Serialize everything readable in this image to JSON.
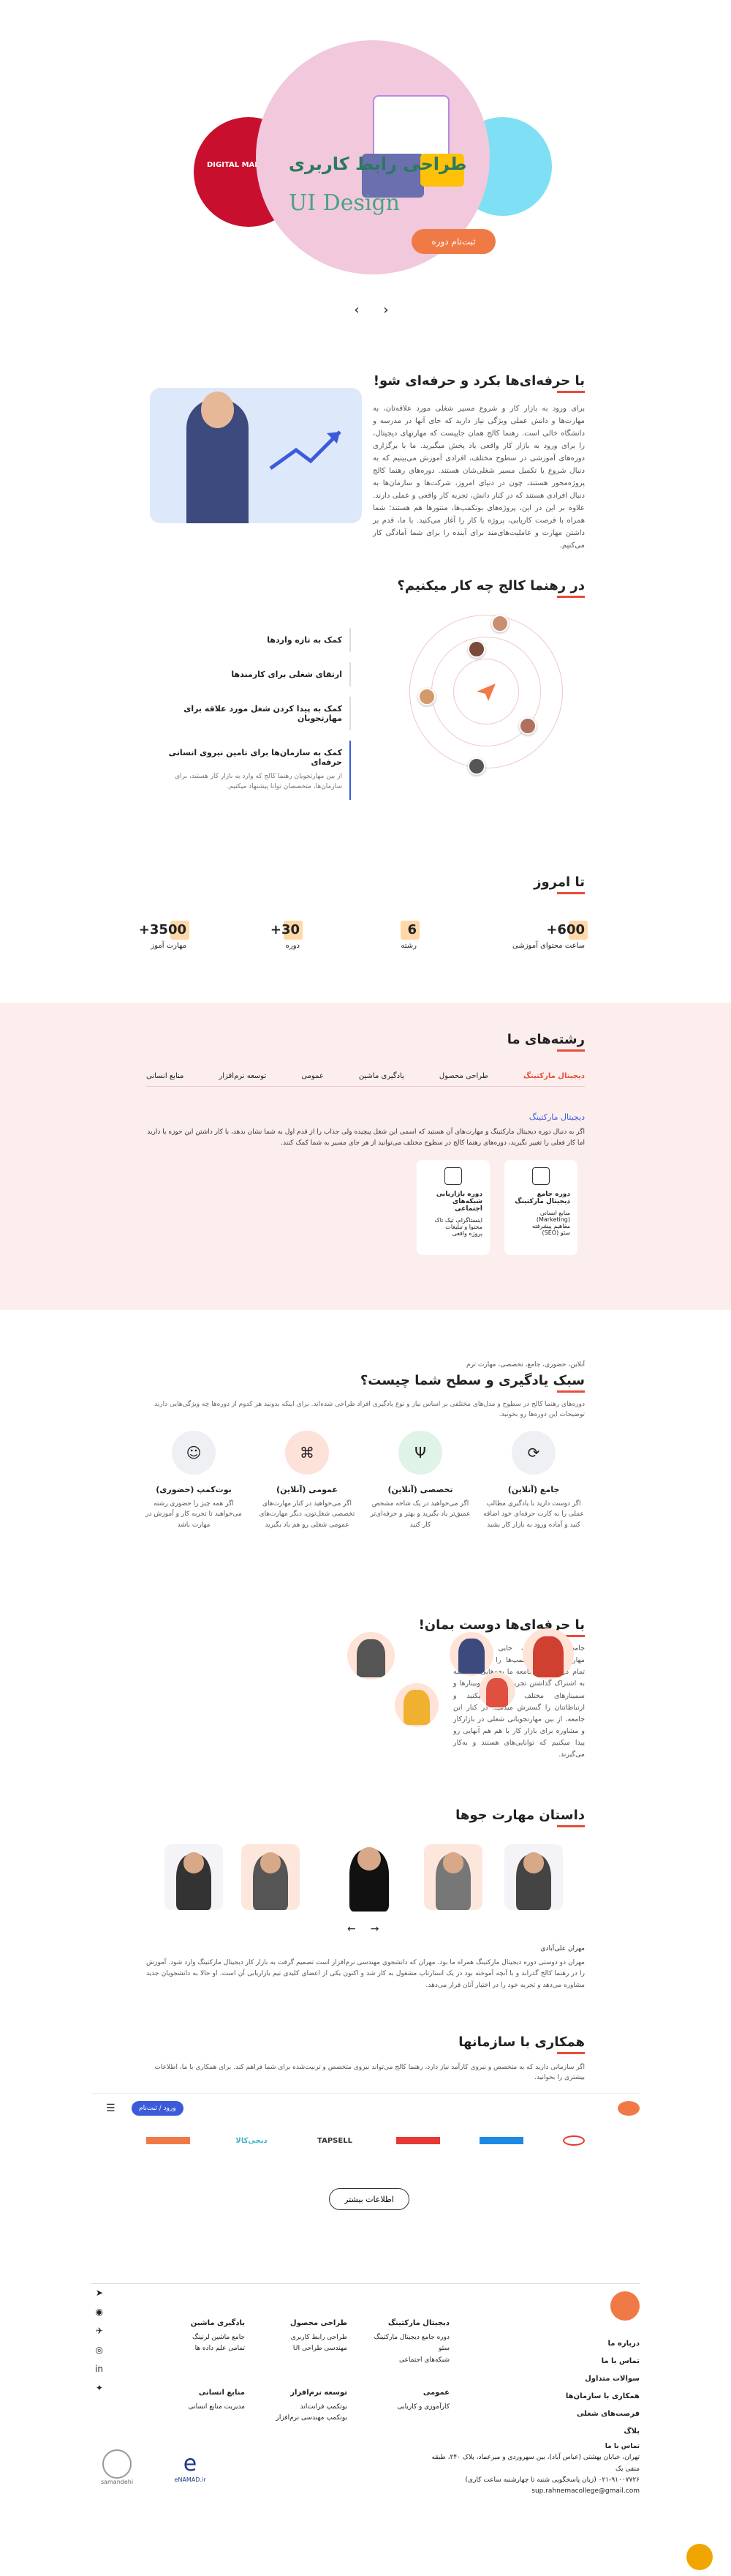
{
  "hero": {
    "course_title_fa": "طراحی رابط کاربری",
    "course_title_en": "UI Design",
    "enroll_label": "ثبت‌نام دوره",
    "prev_arrow": "‹",
    "next_arrow": "›",
    "left_slide_text": "DIGITAL MARKETING",
    "accent_color": "#f07a46"
  },
  "intro": {
    "heading": "با حرفه‌ای‌ها بکرد و حرفه‌ای شو!",
    "body": "برای ورود به بازار کار و شروع مسیر شغلی مورد علاقه‌تان، به مهارت‌ها و دانش عملی ویژگی نیاز دارید که جای آنها در مدرسه و دانشگاه خالی است. رهنما کالج همان جاییست که مهارتهای دیجیتال، را برای ورود به بازار کار واقعی یاد پخش میگیرید. ما با برگزاری دوره‌های آموزشی در سطوح مختلف، افرادی آموزش می‌بینیم که به دنبال شروع یا تکمیل مسیر شغلی‌شان هستند. دوره‌های رهنما کالج پروژه‌محور هستند، چون در دنیای امروز، شرکت‌ها و سازمان‌ها به دنبال افرادی هستند که در کنار دانش، تجربه کار واقعی و عملی دارند. علاوه بر این در این، پروژه‌های بوتکمپ‌ها، منتورها هم هستند؛ شما همراه با فرصت کاریابی، پروژه یا کار را آغاز می‌کنید. با ما، قدم بر داشتن مهارت و عاملیت‌های‌مند برای آینده را برای شما آمادگی کار می‌کنیم."
  },
  "what": {
    "heading": "در رهنما کالج چه کار میکنیم؟",
    "items": [
      {
        "title": "کمک به تازه واردها",
        "text": ""
      },
      {
        "title": "ارتقای شغلی برای کارمندها",
        "text": ""
      },
      {
        "title": "کمک به پیدا کردن شغل مورد علاقه برای مهارتجویان",
        "text": ""
      },
      {
        "title": "کمک به سازمان‌ها برای تامین نیروی انسانی حرفه‌ای",
        "text": "از بین مهارتجویان رهنما کالج که وارد به بازار کار هستند، برای سازمان‌ها، متخصصان توانا پیشنهاد میکنیم."
      }
    ]
  },
  "stats": {
    "heading": "تا امروز",
    "items": [
      {
        "num": "600+",
        "label": "ساعت محتوای آموزشی"
      },
      {
        "num": "6",
        "label": "رشته"
      },
      {
        "num": "30+",
        "label": "دوره"
      },
      {
        "num": "3500+",
        "label": "مهارت آموز"
      }
    ]
  },
  "fields": {
    "heading": "رشته‌های ما",
    "tabs": [
      "دیجیتال مارکتینگ",
      "طراحی محصول",
      "یادگیری ماشین",
      "عمومی",
      "توسعه نرم‌افزار",
      "منابع انسانی"
    ],
    "active_title": "دیجیتال مارکتینگ",
    "desc": "اگر به دنبال دوره دیجیتال مارکتینگ و مهارت‌های آن هستید که اسمی این شغل پیچیده ولی جذاب را از قدم اول به شما نشان بدهد، با کار داشتن این حوزه یا دارید اما کار فعلی را تغییر نگیرید، دوره‌های رهنما کالج در سطوح مختلف می‌توانید از هر جای مسیر به شما کمک کنند.",
    "cards": [
      {
        "title": "دوره جامع دیجیتال مارکتینگ",
        "lines": [
          "منابع انسانی (Marketing)",
          "مفاهیم پیشرفته",
          "سئو (SEO)"
        ]
      },
      {
        "title": "دوره بازاریابی شبکه‌های اجتماعی",
        "lines": [
          "اینستاگرام، تیک تاک",
          "محتوا و تبلیغات",
          "پروژه واقعی"
        ]
      }
    ]
  },
  "style": {
    "sub": "آنلاین، حضوری، جامع، تخصصی، مهارت ترم",
    "heading": "سبک یادگیری و سطح شما چیست؟",
    "desc": "دوره‌های رهنما کالج در سطوح و مدل‌های مختلفی بر اساس نیاز و نوع یادگیری افراد طراحی شده‌اند. برای اینکه بدونید هر کدوم از دوره‌ها چه ویژگی‌هایی دارند توضیحات این دوره‌ها رو بخونید.",
    "items": [
      {
        "title": "جامع (آنلاین)",
        "text": "اگر دوست دارید با یادگیری مطالب عملی را به کارت حرفه‌ای خود اضافه کنید و آماده ورود به بازار کار بشید"
      },
      {
        "title": "تخصصی (آنلاین)",
        "text": "اگر می‌خواهید در یک شاخه مشخص عمیق‌تر یاد بگیرید و بهتر و حرفه‌ای‌تر کار کنید"
      },
      {
        "title": "عمومی (آنلاین)",
        "text": "اگر می‌خواهید در کنار مهارت‌های تخصصی شغل‌تون، دیگر مهارت‌های عمومی شغلی رو هم یاد بگیرید"
      },
      {
        "title": "بوت‌کمپ (حضوری)",
        "text": "اگر همه چیز را حضوری رشته می‌خواهید تا تجربه کار و آموزش در مهارت باشد"
      }
    ]
  },
  "people": {
    "heading": "با حرفه‌ای‌ها دوست بمان!",
    "body": "جامعه رهنما کالج، جایی است برای مهارتجویانی که بوتکمپ‌ها را با موفقیت‌ها تمام کرده‌اند، در جامعه ما بچه‌هایی با سابقه به اشتراک گذاشتن تجربیاتشان، در وبینارها و سمینارهای مختلف شرکت میکنید و ارتباطاتتان را گسترش میدهید. در کنار این جامعه، از بین مهارتجویانی شغلی در بازارکار و مشاوره برای بازار کار با هم هم آنهایی رو پیدا میکنیم که توانایی‌های هستند و به‌کار می‌گیرند."
  },
  "story": {
    "heading": "داستان مهارت جوها",
    "prev": "←",
    "next": "→",
    "name": "مهران علی‌آبادی",
    "text": "مهران دو دوستی دوره دیجیتال مارکتینگ همراه ما بود. مهران که دانشجوی مهندسی نرم‌افزار است تصمیم گرفت به بازار کار دیجیتال مارکتینگ وارد شود. آموزش را در رهنما کالج گذراند و با آنچه آموخته بود در یک استارتاپ مشغول به کار شد و اکنون یکی از اعضای کلیدی تیم بازاریابی آن است. او حالا به دانشجویان جدید مشاوره می‌دهد و تجربه خود را در اختیار آنان قرار می‌دهد."
  },
  "partners": {
    "heading": "همکاری با سازمانها",
    "desc": "اگر سازمانی دارید که به متخصص و نیروی کارآمد نیاز دارد، رهنما کالج می‌تواند نیروی متخصص و تربیت‌شده برای شما فراهم کند. برای همکاری با ما، اطلاعات بیشتری را بخوانید.",
    "logos": [
      "",
      "دیجی‌کالا",
      "TAPSELL",
      "",
      "",
      ""
    ],
    "more_label": "اطلاعات بیشتر"
  },
  "topbar": {
    "login_label": "ورود / ثبت‌نام",
    "menu_icon": "☰"
  },
  "footer": {
    "links": [
      "درباره ما",
      "تماس با ما",
      "سوالات متداول",
      "همکاری با سازمان‌ها",
      "فرصت‌های شغلی",
      "بلاگ"
    ],
    "cols": [
      {
        "title": "دیجیتال مارکتینگ",
        "lines": [
          "دوره جامع دیجیتال مارکتینگ",
          "سئو",
          "شبکه‌های اجتماعی"
        ]
      },
      {
        "title": "طراحی محصول",
        "lines": [
          "طراحی رابط کاربری",
          "مهندسی طراحی UI"
        ]
      },
      {
        "title": "یادگیری ماشین",
        "lines": [
          "جامع ماشین لرنینگ",
          "تمامی علم داده ها"
        ]
      },
      {
        "title": "عمومی",
        "lines": [
          "کارآموزی و کاریابی"
        ]
      },
      {
        "title": "توسعه نرم‌افزار",
        "lines": [
          "بوتکمپ فرانت‌اند",
          "بوتکمپ مهندسی نرم‌افزار"
        ]
      },
      {
        "title": "منابع انسانی",
        "lines": [
          "مدیریت منابع انسانی"
        ]
      }
    ],
    "contact_title": "تماس با ما",
    "address": "تهران، خیابان بهشتی (عباس آباد)، بین سهروردی و میرعماد، پلاک ۲۴۰، طبقه منفی یک",
    "phone": "۰۲۱-۹۱۰۰۷۷۲۶ (زبان پاسخگویی شنبه تا چهارشنبه ساعت کاری)",
    "email": "sup.rahnemacollege@gmail.com",
    "badge1": "eNAMAD.ir",
    "badge2": "samandehi"
  }
}
